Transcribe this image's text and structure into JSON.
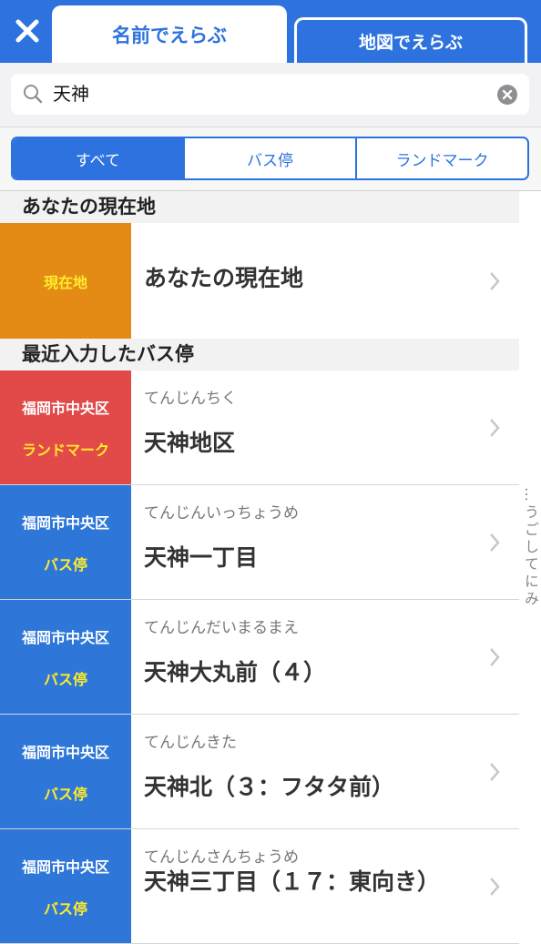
{
  "header": {
    "tab_name": "名前でえらぶ",
    "tab_map": "地図でえらぶ"
  },
  "search": {
    "value": "天神"
  },
  "segments": [
    "すべて",
    "バス停",
    "ランドマーク"
  ],
  "sections": {
    "current": "あなたの現在地",
    "recent": "最近入力したバス停"
  },
  "current_location": {
    "tag": "現在地",
    "name": "あなたの現在地"
  },
  "rows": [
    {
      "area": "福岡市中央区",
      "type": "ランドマーク",
      "reading": "てんじんちく",
      "name": "天神地区",
      "color": "#e24a4a"
    },
    {
      "area": "福岡市中央区",
      "type": "バス停",
      "reading": "てんじんいっちょうめ",
      "name": "天神一丁目",
      "color": "#2e77d8"
    },
    {
      "area": "福岡市中央区",
      "type": "バス停",
      "reading": "てんじんだいまるまえ",
      "name": "天神大丸前（４）",
      "color": "#2e77d8"
    },
    {
      "area": "福岡市中央区",
      "type": "バス停",
      "reading": "てんじんきた",
      "name": "天神北（３：フタタ前）",
      "color": "#2e77d8"
    },
    {
      "area": "福岡市中央区",
      "type": "バス停",
      "reading": "てんじんさんちょうめ",
      "name": "天神三丁目（１７：東向き）",
      "color": "#2e77d8"
    }
  ],
  "side_hint": "…うごしてにみ"
}
